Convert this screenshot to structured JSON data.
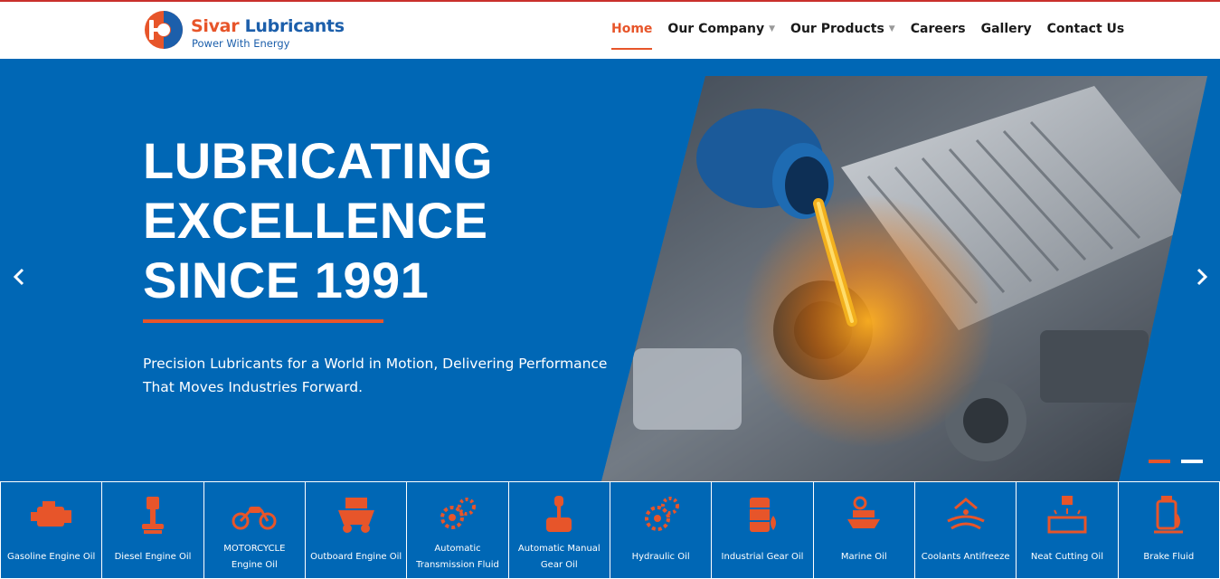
{
  "brand": {
    "logo_prefix": "Sivar",
    "logo_name": "Lubricants",
    "tagline": "Power With Energy"
  },
  "nav": {
    "items": [
      {
        "label": "Home",
        "active": true,
        "dropdown": false
      },
      {
        "label": "Our Company",
        "active": false,
        "dropdown": true
      },
      {
        "label": "Our Products",
        "active": false,
        "dropdown": true
      },
      {
        "label": "Careers",
        "active": false,
        "dropdown": false
      },
      {
        "label": "Gallery",
        "active": false,
        "dropdown": false
      },
      {
        "label": "Contact Us",
        "active": false,
        "dropdown": false
      }
    ]
  },
  "hero": {
    "headline": [
      "LUBRICATING",
      "EXCELLENCE",
      "SINCE 1991"
    ],
    "subtitle": "Precision Lubricants for a World in Motion, Delivering Performance That Moves Industries Forward.",
    "prev_icon": "chevron-left-icon",
    "next_icon": "chevron-right-icon",
    "slides": 2,
    "active_slide": 1,
    "image_description_icon": "engine-oil-pour-photo"
  },
  "categories": [
    {
      "label": "Gasoline Engine Oil",
      "icon": "engine-icon"
    },
    {
      "label": "Diesel Engine Oil",
      "icon": "piston-icon"
    },
    {
      "label": "MOTORCYCLE Engine Oil",
      "icon": "motorcycle-icon"
    },
    {
      "label": "Outboard Engine Oil",
      "icon": "ship-icon"
    },
    {
      "label": "Automatic Transmission Fluid",
      "icon": "gears-icon"
    },
    {
      "label": "Automatic Manual Gear Oil",
      "icon": "gear-shift-icon"
    },
    {
      "label": "Hydraulic Oil",
      "icon": "gears-icon"
    },
    {
      "label": "Industrial Gear Oil",
      "icon": "oil-barrel-icon"
    },
    {
      "label": "Marine Oil",
      "icon": "marine-boat-icon"
    },
    {
      "label": "Coolants Antifreeze",
      "icon": "coolant-icon"
    },
    {
      "label": "Neat Cutting Oil",
      "icon": "cutting-machine-icon"
    },
    {
      "label": "Brake Fluid",
      "icon": "brake-fluid-icon"
    }
  ],
  "colors": {
    "primary_blue": "#0067b5",
    "accent_orange": "#e7552a",
    "brand_blue": "#1c5fab"
  }
}
